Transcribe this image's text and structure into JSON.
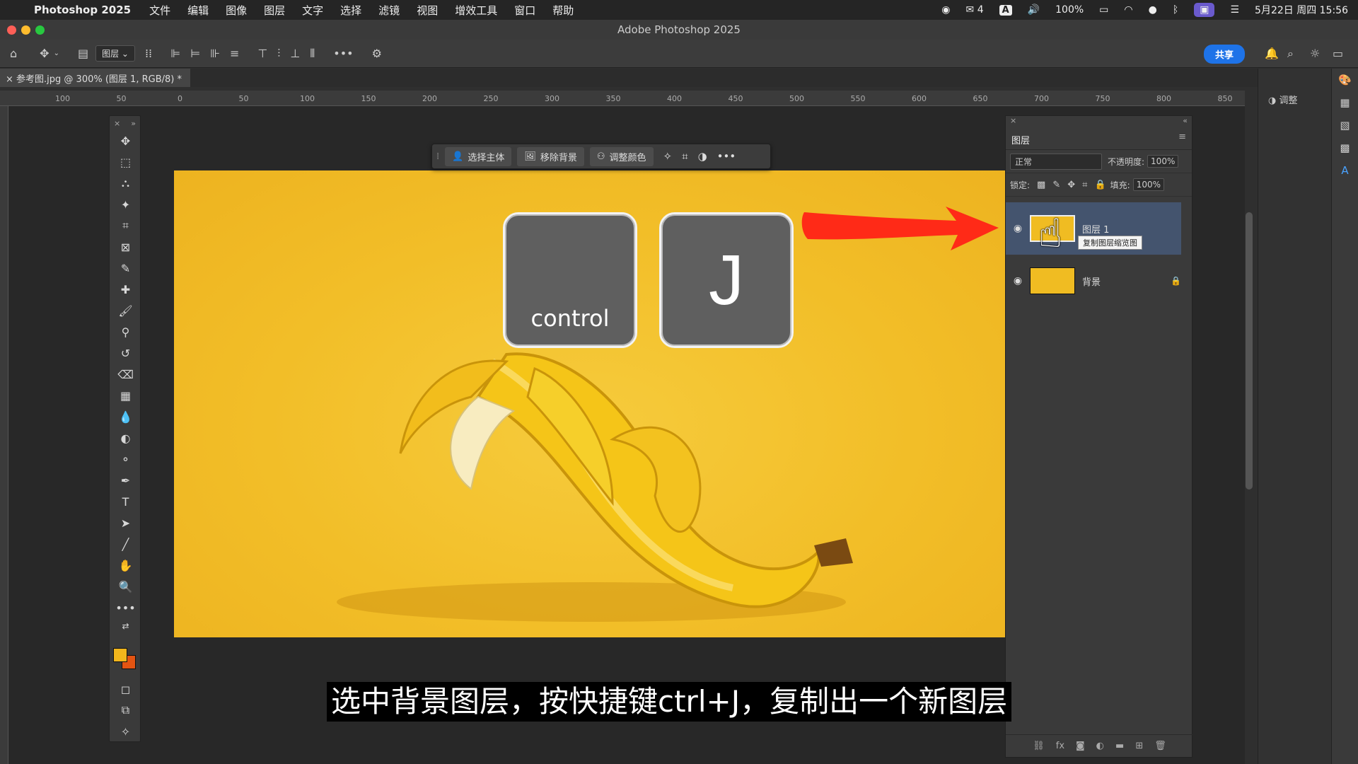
{
  "menubar": {
    "app": "Photoshop 2025",
    "items": [
      "文件",
      "编辑",
      "图像",
      "图层",
      "文字",
      "选择",
      "滤镜",
      "视图",
      "增效工具",
      "窗口",
      "帮助"
    ],
    "status": {
      "wechat_count": "4",
      "input": "A",
      "battery": "100%",
      "datetime": "5月22日 周四 15:56"
    }
  },
  "window": {
    "title": "Adobe Photoshop 2025"
  },
  "options": {
    "layer_select": "图层",
    "share": "共享"
  },
  "document": {
    "tab": "参考图.jpg @ 300% (图层 1, RGB/8) *"
  },
  "ruler": {
    "ticks": [
      "100",
      "50",
      "0",
      "50",
      "100",
      "150",
      "200",
      "250",
      "300",
      "350",
      "400",
      "450",
      "500",
      "550",
      "600",
      "650",
      "700",
      "750",
      "800",
      "850"
    ]
  },
  "context_bar": {
    "select_subject": "选择主体",
    "remove_bg": "移除背景",
    "adjust_color": "调整颜色"
  },
  "keys": {
    "control": "control",
    "j": "J"
  },
  "layers_panel": {
    "title": "图层",
    "blend_mode": "正常",
    "opacity_label": "不透明度:",
    "opacity": "100%",
    "lock_label": "锁定:",
    "fill_label": "填充:",
    "fill": "100%",
    "layers": [
      {
        "name": "图层 1",
        "tooltip": "复制图层缩览图"
      },
      {
        "name": "背景"
      }
    ]
  },
  "adjust_panel": {
    "label": "调整"
  },
  "subtitle": "选中背景图层，按快捷键ctrl+J，复制出一个新图层",
  "colors": {
    "foreground": "#f2b61c",
    "background": "#e35412",
    "share_button": "#1e73e8",
    "selected_layer": "#44546e"
  }
}
